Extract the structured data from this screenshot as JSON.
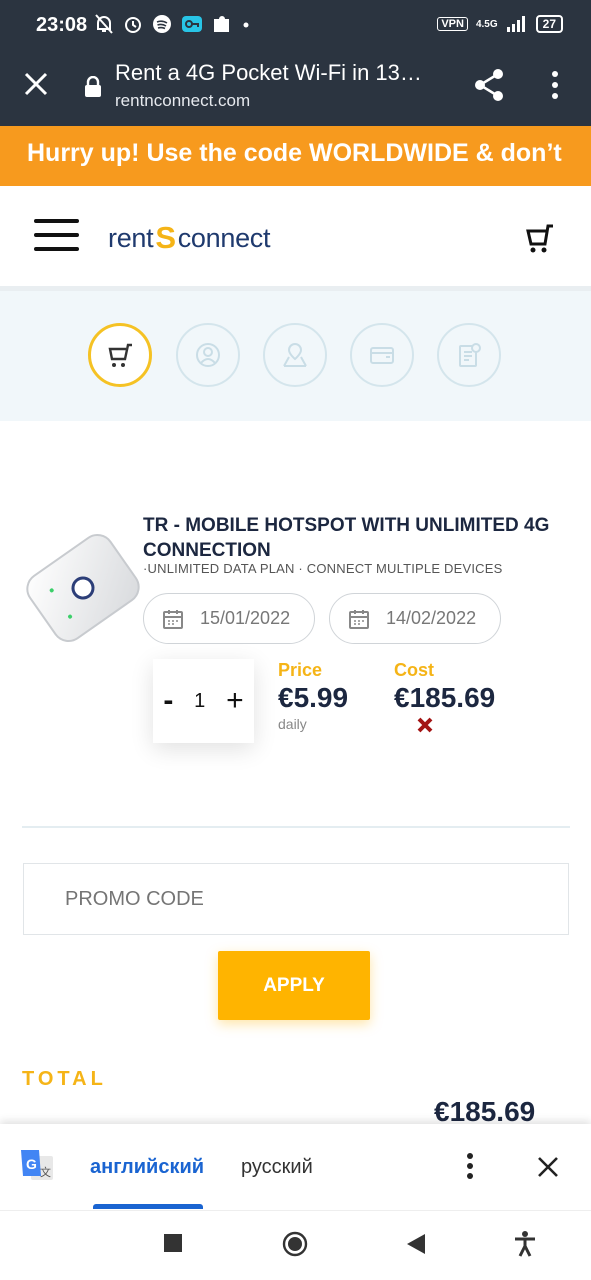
{
  "status_bar": {
    "time": "23:08",
    "vpn": "VPN",
    "network": "4.5G",
    "battery": "27"
  },
  "browser": {
    "page_title": "Rent a 4G Pocket Wi-Fi in 13…",
    "host": "rentnconnect.com"
  },
  "banner": {
    "text": "Hurry up! Use the code WORLDWIDE & don’t"
  },
  "site": {
    "logo_left": "rent",
    "logo_mid": "S",
    "logo_right": "connect"
  },
  "product": {
    "title": "TR - MOBILE HOTSPOT WITH UNLIMITED 4G CONNECTION",
    "features": "·UNLIMITED DATA PLAN · CONNECT MULTIPLE DEVICES",
    "start_date": "15/01/2022",
    "end_date": "14/02/2022",
    "quantity_minus": "-",
    "quantity": "1",
    "quantity_plus": "+",
    "price_label": "Price",
    "price": "€5.99",
    "price_unit": "daily",
    "cost_label": "Cost",
    "cost": "€185.69"
  },
  "promo": {
    "placeholder": "PROMO CODE",
    "apply_label": "APPLY"
  },
  "total": {
    "label": "TOTAL",
    "value": "€185.69"
  },
  "translate_bar": {
    "source_lang": "английский",
    "target_lang": "русский"
  },
  "colors": {
    "banner": "#f79a1e",
    "accent": "#f5b417",
    "navy": "#1c2740",
    "apply": "#ffb400"
  }
}
